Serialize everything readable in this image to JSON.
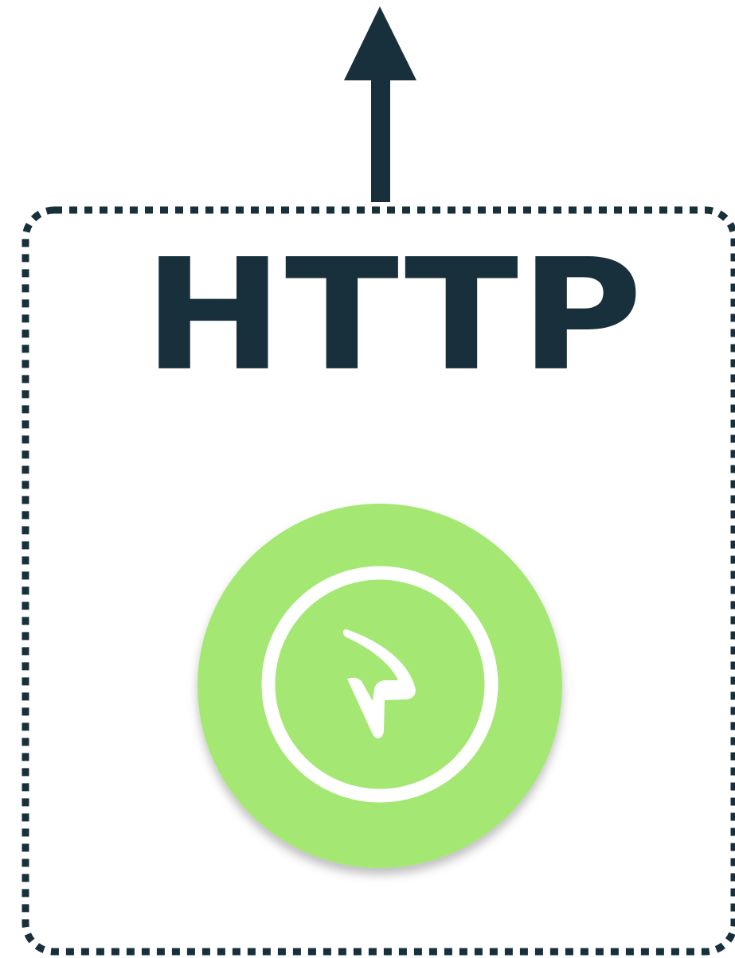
{
  "diagram": {
    "title": "HTTP",
    "colors": {
      "dark": "#17303c",
      "accent_green": "#a4e873",
      "white": "#ffffff"
    },
    "elements": {
      "arrow": "up-arrow",
      "container": "dotted-rounded-box",
      "logo": "green-circle-logo-icon"
    }
  }
}
